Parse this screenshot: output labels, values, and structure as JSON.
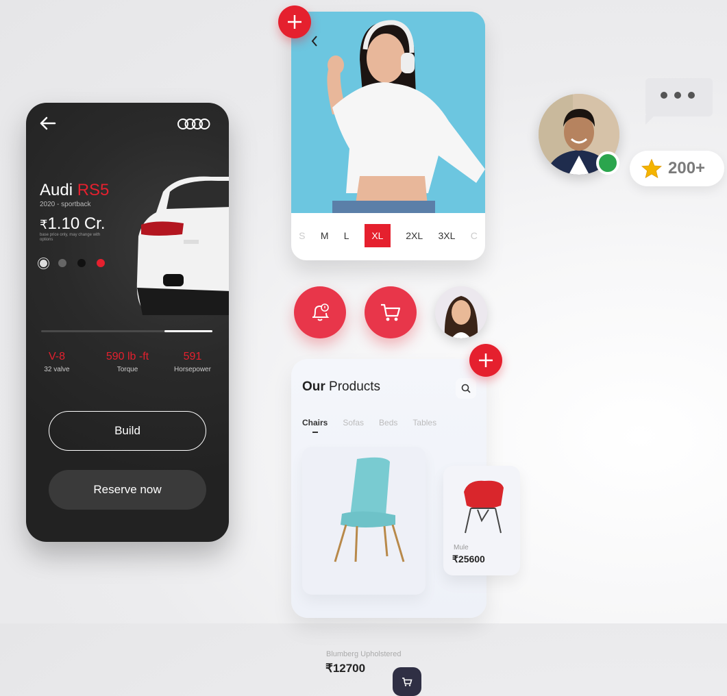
{
  "car": {
    "title_main": "Audi ",
    "title_accent": "RS5",
    "subtitle": "2020 - sportback",
    "currency": "₹",
    "price": "1.10 Cr.",
    "price_note": "base price only, may change with options",
    "specs": [
      {
        "value": "V-8",
        "label": "32 valve"
      },
      {
        "value": "590 lb -ft",
        "label": "Torque"
      },
      {
        "value": "591",
        "label": "Horsepower"
      }
    ],
    "build_label": "Build",
    "reserve_label": "Reserve now",
    "progress_fraction": 0.28
  },
  "fashion": {
    "sizes": [
      "S",
      "M",
      "L",
      "XL",
      "2XL",
      "3XL",
      "C"
    ],
    "selected_size": "XL"
  },
  "products": {
    "title_bold": "Our",
    "title_rest": " Products",
    "tabs": [
      "Chairs",
      "Sofas",
      "Beds",
      "Tables"
    ],
    "items": [
      {
        "name": "Blumberg Upholstered",
        "price": "₹12700"
      },
      {
        "name": "Mule",
        "price": "₹25600"
      }
    ]
  },
  "rating": {
    "text": "200+"
  },
  "colors": {
    "accent": "#e5202e",
    "dark": "#2a2a2a"
  },
  "icons": [
    "plus-icon",
    "bell-icon",
    "cart-icon",
    "search-icon",
    "back-arrow-icon",
    "chevron-left-icon",
    "star-icon",
    "audi-logo"
  ]
}
